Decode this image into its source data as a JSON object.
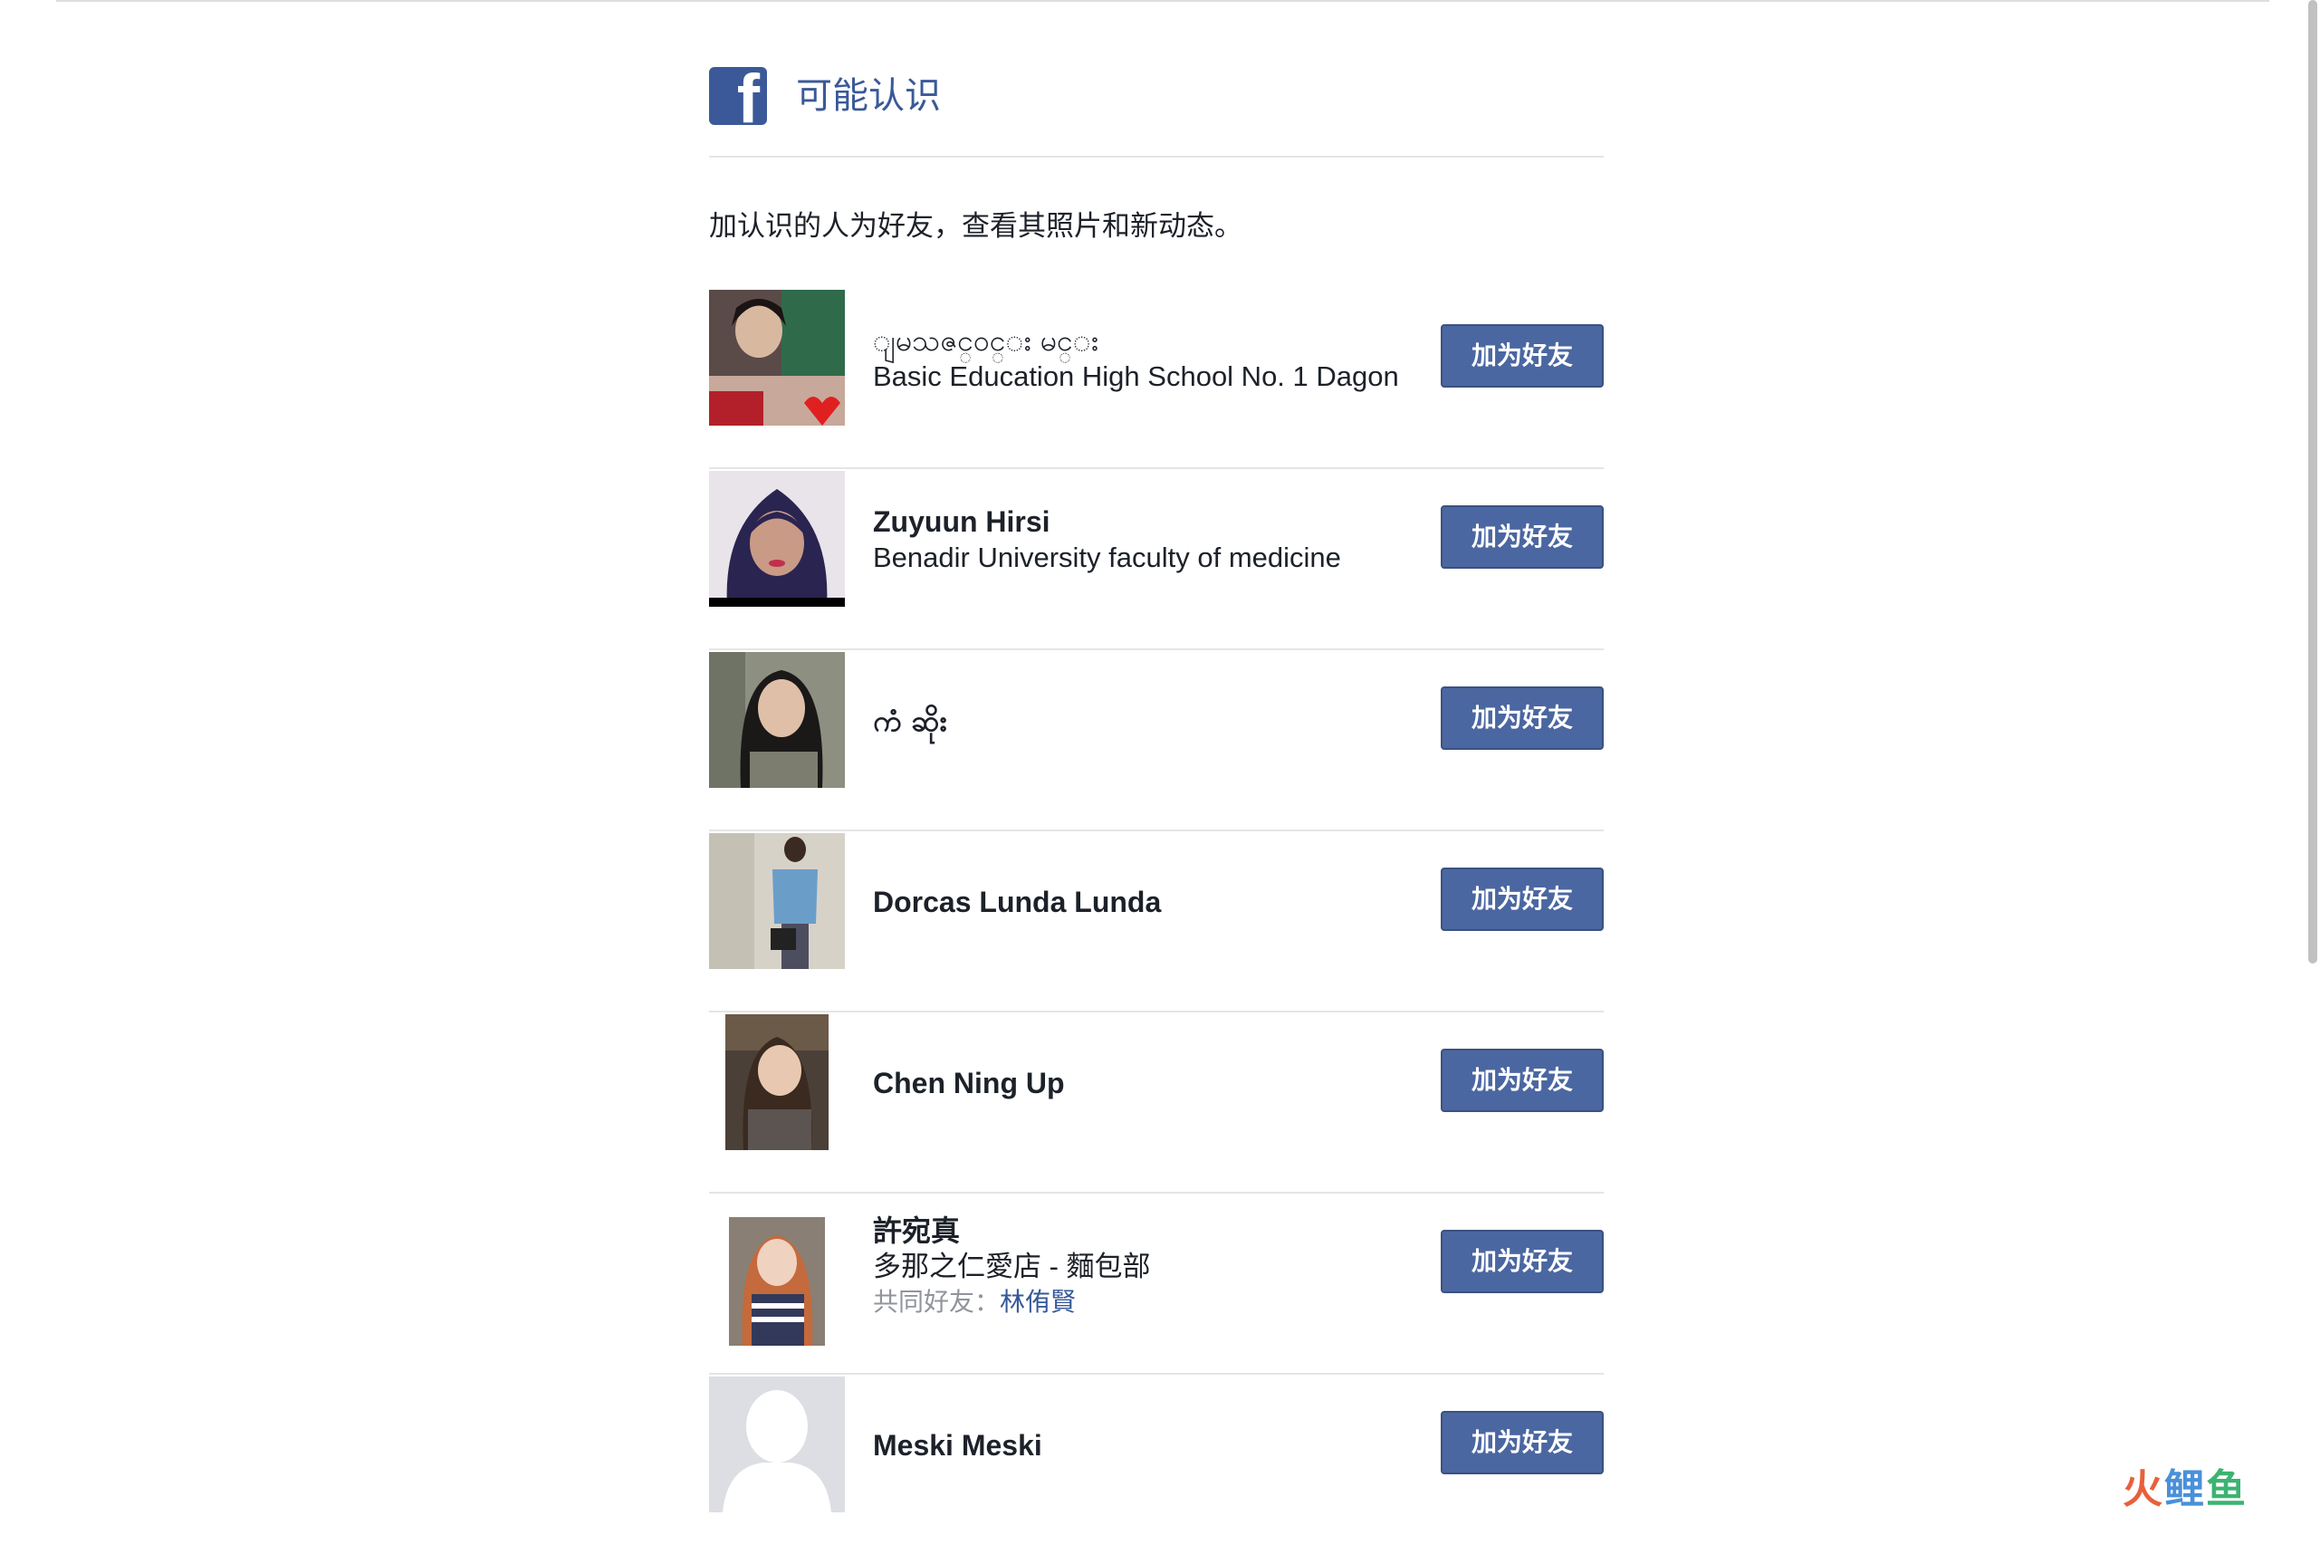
{
  "header": {
    "logo_icon": "facebook-logo-icon",
    "title": "可能认识"
  },
  "intro_text": "加认识的人为好友，查看其照片和新动态。",
  "add_friend_label": "加为好友",
  "people": [
    {
      "name": "ျမသဇင္ဝင္း မင္း",
      "detail": "Basic Education High School No. 1 Dagon",
      "mutual_label": "",
      "mutual_name": "",
      "avatar": "photo-avatar"
    },
    {
      "name": "Zuyuun Hirsi",
      "detail": "Benadir University faculty of medicine",
      "mutual_label": "",
      "mutual_name": "",
      "avatar": "photo-avatar"
    },
    {
      "name": "ကံ ဆိုး",
      "detail": "",
      "mutual_label": "",
      "mutual_name": "",
      "avatar": "photo-avatar"
    },
    {
      "name": "Dorcas Lunda Lunda",
      "detail": "",
      "mutual_label": "",
      "mutual_name": "",
      "avatar": "photo-avatar"
    },
    {
      "name": "Chen Ning Up",
      "detail": "",
      "mutual_label": "",
      "mutual_name": "",
      "avatar": "photo-avatar"
    },
    {
      "name": "許宛真",
      "detail": "多那之仁愛店 - 麵包部",
      "mutual_label": "共同好友：",
      "mutual_name": "林侑賢",
      "avatar": "photo-avatar"
    },
    {
      "name": "Meski Meski",
      "detail": "",
      "mutual_label": "",
      "mutual_name": "",
      "avatar": "default-silhouette-avatar"
    }
  ],
  "watermark": {
    "part1": "火",
    "part2": "鲤",
    "part3": "鱼"
  },
  "colors": {
    "brand": "#3b5998",
    "button": "#4b67a1",
    "divider": "#e5e5e5",
    "muted": "#90949c",
    "link": "#365899"
  }
}
